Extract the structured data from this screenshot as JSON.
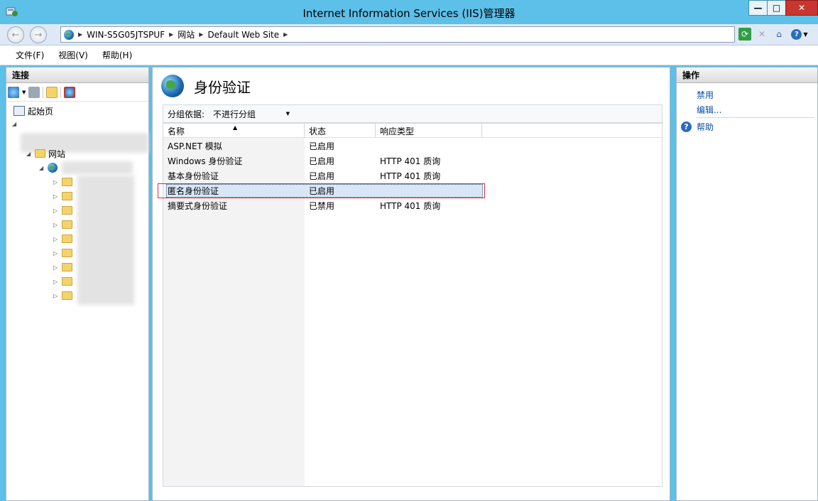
{
  "window": {
    "title": "Internet Information Services (IIS)管理器",
    "minimize_label": "—",
    "maximize_label": "□",
    "close_label": "✕"
  },
  "address": {
    "crumbs": [
      "WIN-S5G05JTSPUF",
      "网站",
      "Default Web Site"
    ],
    "help_label": "?"
  },
  "menu": {
    "items": [
      "文件(F)",
      "视图(V)",
      "帮助(H)"
    ]
  },
  "connections": {
    "header": "连接",
    "tree": {
      "start_page": "起始页",
      "sites": "网站"
    }
  },
  "feature": {
    "title": "身份验证",
    "group_by_label": "分组依据:",
    "group_by_value": "不进行分组",
    "columns": [
      "名称",
      "状态",
      "响应类型"
    ],
    "rows": [
      {
        "name": "ASP.NET 模拟",
        "status": "已启用",
        "response": ""
      },
      {
        "name": "Windows 身份验证",
        "status": "已启用",
        "response": "HTTP 401 质询"
      },
      {
        "name": "基本身份验证",
        "status": "已启用",
        "response": "HTTP 401 质询"
      },
      {
        "name": "匿名身份验证",
        "status": "已启用",
        "response": ""
      },
      {
        "name": "摘要式身份验证",
        "status": "已禁用",
        "response": "HTTP 401 质询"
      }
    ]
  },
  "actions": {
    "header": "操作",
    "disable": "禁用",
    "edit": "编辑...",
    "help": "帮助"
  }
}
